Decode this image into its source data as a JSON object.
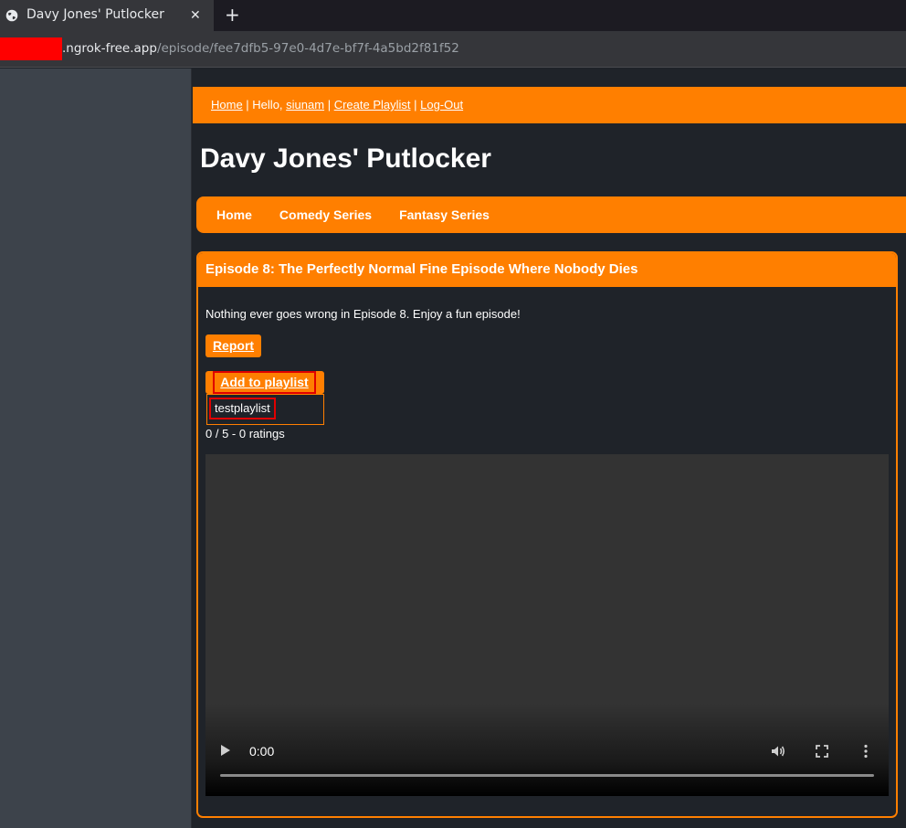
{
  "browser": {
    "tab_title": "Davy Jones' Putlocker",
    "tab_close": "✕",
    "new_tab": "+",
    "url_host": ".ngrok-free.app",
    "url_path": "/episode/fee7dfb5-97e0-4d7e-bf7f-4a5bd2f81f52"
  },
  "topbar": {
    "home_link": "Home",
    "separator": " | ",
    "greeting": "Hello, ",
    "username": "siunam",
    "create_playlist": "Create Playlist",
    "logout": "Log-Out"
  },
  "site": {
    "title": "Davy Jones' Putlocker"
  },
  "nav": {
    "items": [
      {
        "label": "Home"
      },
      {
        "label": "Comedy Series"
      },
      {
        "label": "Fantasy Series"
      }
    ]
  },
  "episode": {
    "title": "Episode 8: The Perfectly Normal Fine Episode Where Nobody Dies",
    "description": "Nothing ever goes wrong in Episode 8. Enjoy a fun episode!",
    "report_label": "Report",
    "add_to_playlist_label": "Add to playlist",
    "playlist_options": [
      "testplaylist"
    ],
    "rating": "0 / 5 - 0 ratings"
  },
  "video": {
    "time": "0:00",
    "controls": [
      "play-icon",
      "volume-icon",
      "fullscreen-icon",
      "more-options-icon"
    ]
  },
  "colors": {
    "accent": "#ff7f00",
    "page_bg": "#1f2329",
    "sidebar_bg": "#3d434b",
    "highlight": "#e00000"
  }
}
